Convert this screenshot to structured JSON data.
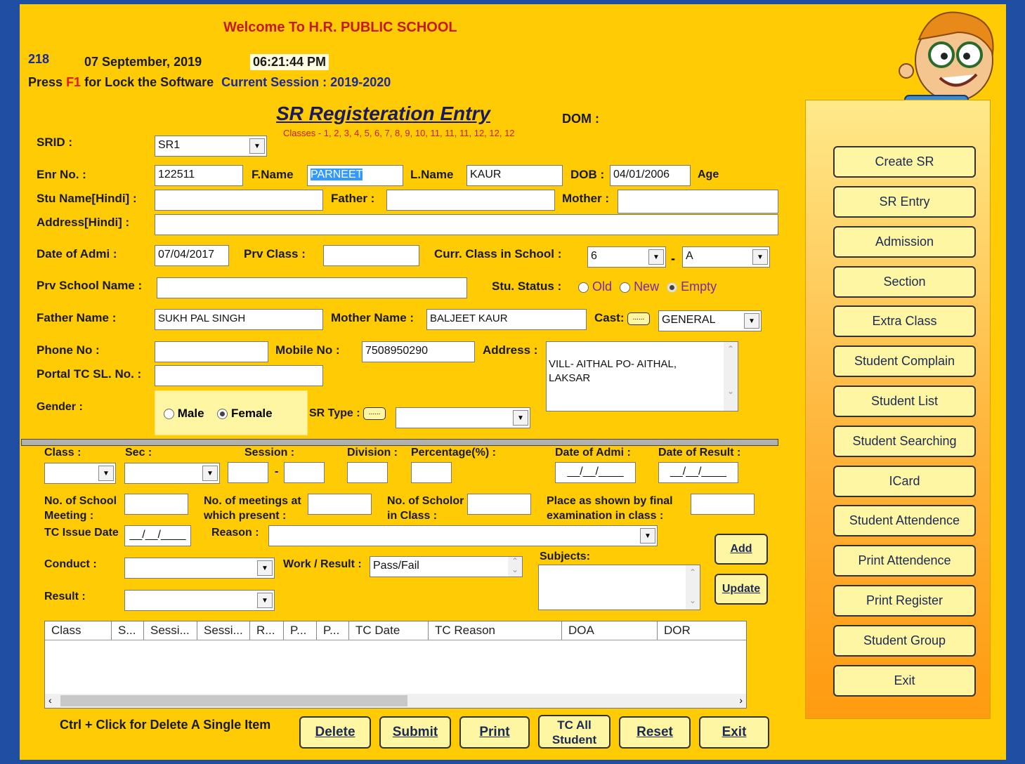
{
  "header": {
    "welcome": "Welcome To  H.R. PUBLIC SCHOOL",
    "code": "218",
    "date": "07 September, 2019",
    "time": "06:21:44 PM",
    "press": "Press",
    "f1": "F1",
    "lock_text": "for Lock the Software",
    "session": "Current Session : 2019-2020"
  },
  "form": {
    "title": "SR Registeration Entry",
    "dom_label": "DOM :",
    "classes_hint": "Classes - 1, 2, 3, 4, 5, 6, 7, 8, 9, 10, 11, 11, 11, 12, 12, 12",
    "srid_label": "SRID :",
    "srid_value": "SR1",
    "enr_label": "Enr No. :",
    "enr_value": "122511",
    "fname_label": "F.Name",
    "fname_value": "PARNEET",
    "lname_label": "L.Name",
    "lname_value": "KAUR",
    "dob_label": "DOB :",
    "dob_value": "04/01/2006",
    "age_label": "Age",
    "stu_hindi_label": "Stu Name[Hindi] :",
    "father_hindi_label": "Father :",
    "mother_hindi_label": "Mother :",
    "address_hindi_label": "Address[Hindi] :",
    "admi_label": "Date of Admi :",
    "admi_value": "07/04/2017",
    "prv_class_label": "Prv Class :",
    "curr_class_label": "Curr. Class in School :",
    "curr_class_value": "6",
    "section_value": "A",
    "prv_school_label": "Prv School Name :",
    "stu_status_label": "Stu. Status :",
    "status_old": "Old",
    "status_new": "New",
    "status_empty": "Empty",
    "father_name_label": "Father Name :",
    "father_name_value": "SUKH PAL SINGH",
    "mother_name_label": "Mother Name :",
    "mother_name_value": "BALJEET KAUR",
    "cast_label": "Cast:",
    "cast_btn": "......",
    "cast_value": "GENERAL",
    "phone_label": "Phone No :",
    "mobile_label": "Mobile No :",
    "mobile_value": "7508950290",
    "address_label": "Address :",
    "address_value": "VILL- AITHAL PO- AITHAL,\nLAKSAR",
    "portal_label": "Portal TC SL. No. :",
    "gender_label": "Gender :",
    "gender_male": "Male",
    "gender_female": "Female",
    "srtype_label": "SR Type :",
    "srtype_btn": "......"
  },
  "lower": {
    "class_label": "Class :",
    "sec_label": "Sec :",
    "session_label": "Session :",
    "division_label": "Division :",
    "percentage_label": "Percentage(%) :",
    "date_admi_label": "Date of Admi :",
    "date_admi_value": "__/__/____",
    "date_result_label": "Date of Result :",
    "date_result_value": "__/__/____",
    "school_meeting_label": "No. of School Meeting :",
    "meetings_present_label": "No. of meetings at which present :",
    "scholor_label": "No. of Scholor in Class :",
    "place_label": "Place as shown by final examination in class :",
    "tc_issue_label": "TC Issue Date",
    "tc_issue_value": "__/__/____",
    "reason_label": "Reason :",
    "conduct_label": "Conduct :",
    "work_result_label": "Work / Result :",
    "work_result_value": "Pass/Fail",
    "subjects_label": "Subjects:",
    "result_label": "Result :",
    "add_btn": "Add",
    "update_btn": "Update"
  },
  "table": {
    "columns": [
      "Class",
      "S...",
      "Sessi...",
      "Sessi...",
      "R...",
      "P...",
      "P...",
      "TC Date",
      "TC Reason",
      "DOA",
      "DOR"
    ]
  },
  "footer": {
    "hint": "Ctrl + Click for Delete  A Single Item",
    "buttons": [
      "Delete",
      "Submit",
      "Print",
      "TC All Student",
      "Reset",
      "Exit"
    ]
  },
  "sidebar": {
    "items": [
      "Create SR",
      "SR Entry",
      "Admission",
      "Section",
      "Extra Class",
      "Student Complain",
      "Student List",
      "Student Searching",
      "ICard",
      "Student Attendence",
      "Print Attendence",
      "Print Register",
      "Student Group",
      "Exit"
    ]
  },
  "icons": {
    "mascot": "cartoon-boy-with-laptop-icon",
    "dropdown": "chevron-down-icon"
  },
  "colors": {
    "background": "#ffcb05",
    "frame": "#1f4ea3",
    "welcome": "#c41a1a",
    "session": "#1a2a9c",
    "button_fill": "#fff6a3"
  }
}
